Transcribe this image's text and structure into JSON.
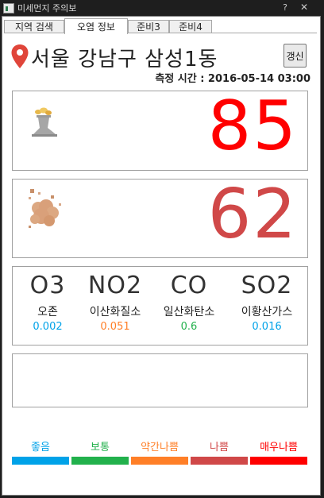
{
  "window": {
    "title": "미세먼지 주의보",
    "help_glyph": "?",
    "close_glyph": "✕"
  },
  "tabs": [
    {
      "label": "지역 검색",
      "active": false
    },
    {
      "label": "오염 정보",
      "active": true
    },
    {
      "label": "준비3",
      "active": false
    },
    {
      "label": "준비4",
      "active": false
    }
  ],
  "location": {
    "icon": "map-pin-icon",
    "name": "서울 강남구 삼성1동",
    "refresh_label": "갱신",
    "measure_time": "측정 시간 : 2016-05-14 03:00"
  },
  "pm10": {
    "icon": "smokestack-icon",
    "value": "85",
    "color": "#ff0000"
  },
  "pm25": {
    "icon": "dust-cloud-icon",
    "value": "62",
    "color": "#d04848"
  },
  "gases": [
    {
      "formula": "O3",
      "name": "오존",
      "value": "0.002",
      "color": "#00a2e8"
    },
    {
      "formula": "NO2",
      "name": "이산화질소",
      "value": "0.051",
      "color": "#ff7f27"
    },
    {
      "formula": "CO",
      "name": "일산화탄소",
      "value": "0.6",
      "color": "#22b14c"
    },
    {
      "formula": "SO2",
      "name": "이황산가스",
      "value": "0.016",
      "color": "#00a2e8"
    }
  ],
  "legend": [
    {
      "label": "좋음",
      "color": "#00a2e8"
    },
    {
      "label": "보통",
      "color": "#22b14c"
    },
    {
      "label": "약간나쁨",
      "color": "#ff7f27"
    },
    {
      "label": "나쁨",
      "color": "#d04848"
    },
    {
      "label": "매우나쁨",
      "color": "#ff0000"
    }
  ]
}
